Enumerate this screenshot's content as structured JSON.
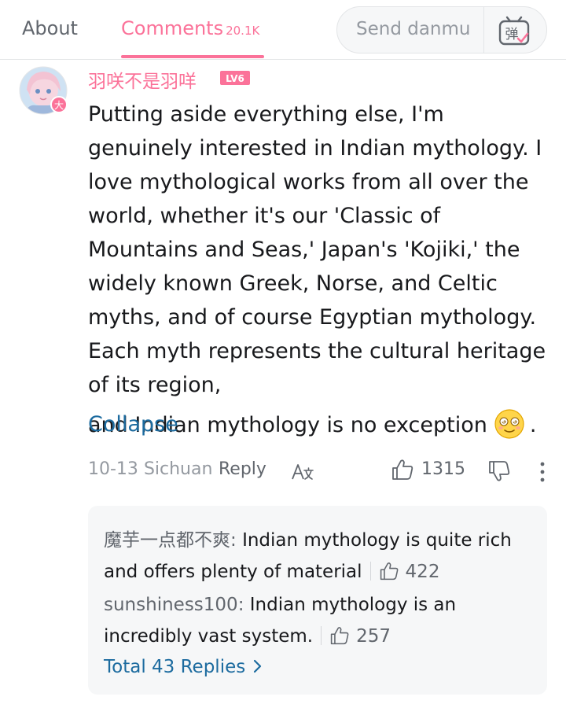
{
  "tabs": {
    "about": "About",
    "comments": "Comments",
    "comments_count": "20.1K"
  },
  "danmu": {
    "placeholder": "Send danmu",
    "icon": "danmu-toggle-icon",
    "icon_glyph": "弹"
  },
  "colors": {
    "accent_pink": "#fb7299",
    "link_blue": "#1c6b9f",
    "muted_gray": "#9499a0"
  },
  "comment": {
    "username": "羽咲不是羽咩",
    "level": "LV6",
    "avatar_badge_glyph": "大",
    "text": "Putting aside everything else, I'm genuinely interested in Indian mythology. I love mythological works from all over the world, whether it's our 'Classic of Mountains and Seas,' Japan's 'Kojiki,' the widely known Greek, Norse, and Celtic myths, and of course Egyptian mythology. Each myth represents the cultural heritage of its region,",
    "text_last_line": "and Indian mythology is no exception",
    "text_end": ".",
    "emoji": "dizzy-smile-emoji",
    "collapse_label": "Collapse",
    "date": "10-13",
    "location": "Sichuan",
    "reply_label": "Reply",
    "likes": "1315"
  },
  "replies": [
    {
      "author": "魔芋一点都不爽",
      "text": "Indian mythology is quite rich and offers plenty of material",
      "likes": "422"
    },
    {
      "author": "sunshiness100",
      "text": "Indian mythology is an incredibly vast system.",
      "likes": "257"
    }
  ],
  "total_replies_label": "Total 43 Replies"
}
